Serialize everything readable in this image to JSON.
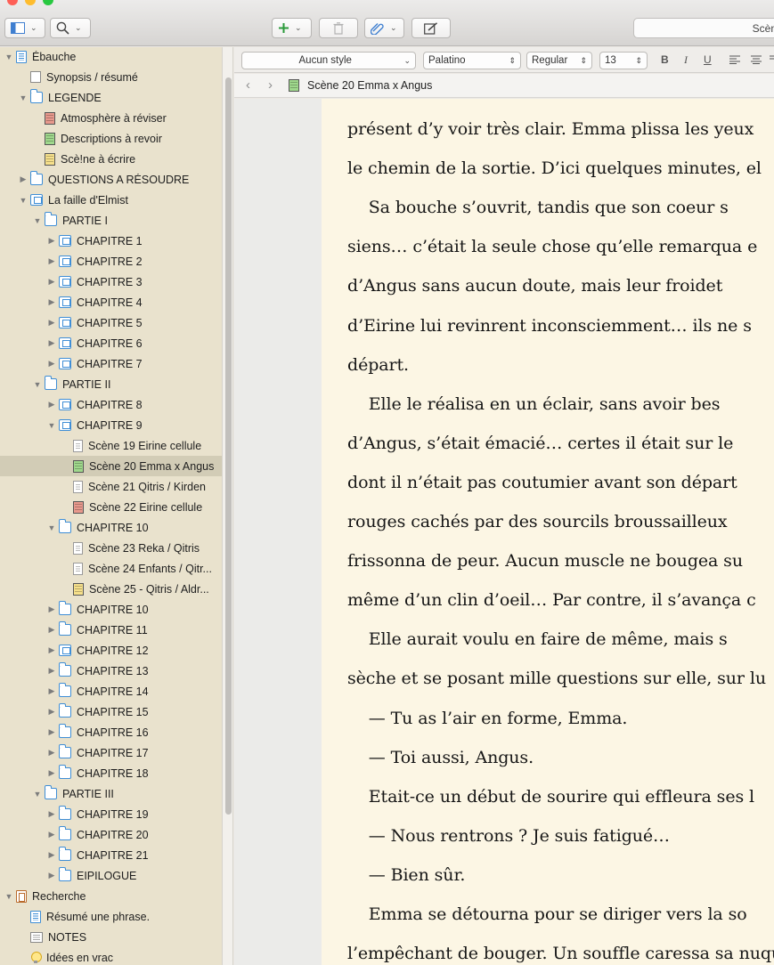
{
  "toolbar": {
    "window_controls": [
      {
        "name": "close",
        "color": "#fe5f57"
      },
      {
        "name": "minimize",
        "color": "#febc2e"
      },
      {
        "name": "zoom",
        "color": "#28c840"
      }
    ],
    "view_icon": "sidebar-view-icon",
    "search_icon": "magnifier-icon",
    "add_icon": "plus-icon",
    "add_color": "#2a9a3a",
    "trash_icon": "trash-icon",
    "attach_icon": "paperclip-icon",
    "compose_icon": "compose-icon",
    "search_field_text": "Scèn"
  },
  "binder": {
    "items": [
      {
        "label": "Ébauche",
        "icon": "book",
        "disclosure": "open",
        "level": 0
      },
      {
        "label": "Synopsis / résumé",
        "icon": "blank-page",
        "disclosure": "none",
        "level": 1
      },
      {
        "label": "LEGENDE",
        "icon": "folder",
        "disclosure": "open",
        "level": 1
      },
      {
        "label": "Atmosphère à réviser",
        "icon": "index-card",
        "color": "#e8998d",
        "disclosure": "none",
        "level": 2
      },
      {
        "label": "Descriptions à revoir",
        "icon": "index-card",
        "color": "#9fd88c",
        "disclosure": "none",
        "level": 2
      },
      {
        "label": "Scè!ne à écrire",
        "icon": "index-card",
        "color": "#f6e08b",
        "disclosure": "none",
        "level": 2
      },
      {
        "label": "QUESTIONS A RÉSOUDRE",
        "icon": "folder",
        "disclosure": "closed",
        "level": 1
      },
      {
        "label": "La faille d'Elmist",
        "icon": "folder-stack",
        "disclosure": "open",
        "level": 1
      },
      {
        "label": "PARTIE  I",
        "icon": "folder",
        "disclosure": "open",
        "level": 2
      },
      {
        "label": "CHAPITRE 1",
        "icon": "folder-stack",
        "disclosure": "closed",
        "level": 3
      },
      {
        "label": "CHAPITRE 2",
        "icon": "folder-stack",
        "disclosure": "closed",
        "level": 3
      },
      {
        "label": "CHAPITRE 3",
        "icon": "folder-stack",
        "disclosure": "closed",
        "level": 3
      },
      {
        "label": "CHAPITRE 4",
        "icon": "folder-stack",
        "disclosure": "closed",
        "level": 3
      },
      {
        "label": "CHAPITRE 5",
        "icon": "folder-stack",
        "disclosure": "closed",
        "level": 3
      },
      {
        "label": "CHAPITRE 6",
        "icon": "folder-stack",
        "disclosure": "closed",
        "level": 3
      },
      {
        "label": "CHAPITRE 7",
        "icon": "folder-stack",
        "disclosure": "closed",
        "level": 3
      },
      {
        "label": "PARTIE  II",
        "icon": "folder",
        "disclosure": "open",
        "level": 2
      },
      {
        "label": "CHAPITRE 8",
        "icon": "folder-stack",
        "disclosure": "closed",
        "level": 3
      },
      {
        "label": "CHAPITRE 9",
        "icon": "folder-stack",
        "disclosure": "open",
        "level": 3
      },
      {
        "label": "Scène 19 Eirine cellule",
        "icon": "document",
        "disclosure": "none",
        "level": 4
      },
      {
        "label": "Scène 20 Emma x Angus",
        "icon": "index-card",
        "color": "#9fd88c",
        "disclosure": "none",
        "level": 4,
        "selected": true
      },
      {
        "label": "Scène 21 Qitris / Kirden",
        "icon": "document",
        "disclosure": "none",
        "level": 4
      },
      {
        "label": "Scène 22 Eirine cellule",
        "icon": "index-card",
        "color": "#e8998d",
        "disclosure": "none",
        "level": 4
      },
      {
        "label": "CHAPITRE 10",
        "icon": "folder",
        "disclosure": "open",
        "level": 3
      },
      {
        "label": "Scène 23 Reka / Qitris",
        "icon": "document",
        "disclosure": "none",
        "level": 4
      },
      {
        "label": "Scène 24 Enfants / Qitr...",
        "icon": "document",
        "disclosure": "none",
        "level": 4
      },
      {
        "label": "Scène 25 - Qitris / Aldr...",
        "icon": "index-card",
        "color": "#f6e08b",
        "disclosure": "none",
        "level": 4
      },
      {
        "label": "CHAPITRE 10",
        "icon": "folder",
        "disclosure": "closed",
        "level": 3
      },
      {
        "label": "CHAPITRE 11",
        "icon": "folder",
        "disclosure": "closed",
        "level": 3
      },
      {
        "label": "CHAPITRE 12",
        "icon": "folder-stack",
        "disclosure": "closed",
        "level": 3
      },
      {
        "label": "CHAPITRE 13",
        "icon": "folder",
        "disclosure": "closed",
        "level": 3
      },
      {
        "label": "CHAPITRE 14",
        "icon": "folder",
        "disclosure": "closed",
        "level": 3
      },
      {
        "label": "CHAPITRE 15",
        "icon": "folder",
        "disclosure": "closed",
        "level": 3
      },
      {
        "label": "CHAPITRE 16",
        "icon": "folder",
        "disclosure": "closed",
        "level": 3
      },
      {
        "label": "CHAPITRE 17",
        "icon": "folder",
        "disclosure": "closed",
        "level": 3
      },
      {
        "label": "CHAPITRE 18",
        "icon": "folder",
        "disclosure": "closed",
        "level": 3
      },
      {
        "label": "PARTIE  III",
        "icon": "folder",
        "disclosure": "open",
        "level": 2
      },
      {
        "label": "CHAPITRE 19",
        "icon": "folder",
        "disclosure": "closed",
        "level": 3
      },
      {
        "label": "CHAPITRE 20",
        "icon": "folder",
        "disclosure": "closed",
        "level": 3
      },
      {
        "label": "CHAPITRE 21",
        "icon": "folder",
        "disclosure": "closed",
        "level": 3
      },
      {
        "label": "EIPILOGUE",
        "icon": "folder",
        "disclosure": "closed",
        "level": 3
      },
      {
        "label": "Recherche",
        "icon": "research",
        "disclosure": "open",
        "level": 0
      },
      {
        "label": "Résumé une phrase.",
        "icon": "book",
        "disclosure": "none",
        "level": 1
      },
      {
        "label": "NOTES",
        "icon": "notes",
        "disclosure": "none",
        "level": 1
      },
      {
        "label": "Idées en vrac",
        "icon": "bulb",
        "disclosure": "none",
        "level": 1
      }
    ]
  },
  "format_bar": {
    "style": "Aucun style",
    "font": "Palatino",
    "weight": "Regular",
    "size": "13",
    "bold_label": "B",
    "italic_label": "I",
    "underline_label": "U"
  },
  "nav": {
    "back_icon": "chevron-left-icon",
    "forward_icon": "chevron-right-icon",
    "document_title": "Scène 20 Emma x Angus",
    "document_icon_color": "#9fd88c"
  },
  "editor": {
    "lines": [
      "présent d’y voir très clair. Emma plissa les yeux",
      "le chemin de la sortie. D’ici quelques minutes, el",
      "    Sa bouche s’ouvrit, tandis que son coeur s",
      "siens… c’était la seule chose qu’elle remarqua e",
      "d’Angus sans aucun doute, mais leur froidet",
      "d’Eirine lui revinrent inconsciemment… ils ne s",
      "départ.",
      "    Elle le réalisa en un éclair, sans avoir bes",
      "d’Angus, s’était émacié… certes il était sur le",
      "dont il n’était pas coutumier avant son départ",
      "rouges cachés par des sourcils broussailleux",
      "frissonna de peur. Aucun muscle ne bougea su",
      "même d’un clin d’oeil… Par contre, il s’avança c",
      "    Elle aurait voulu en faire de même, mais s",
      "sèche et se posant mille questions sur elle, sur lu",
      "    — Tu as l’air en forme, Emma.",
      "    — Toi aussi, Angus.",
      "    Etait-ce un début de sourire qui effleura ses l",
      "    — Nous rentrons ? Je suis fatigué…",
      "    — Bien sûr.",
      "    Emma se détourna pour se diriger vers la so",
      "l’empêchant de bouger. Un souffle caressa sa nuque"
    ]
  }
}
